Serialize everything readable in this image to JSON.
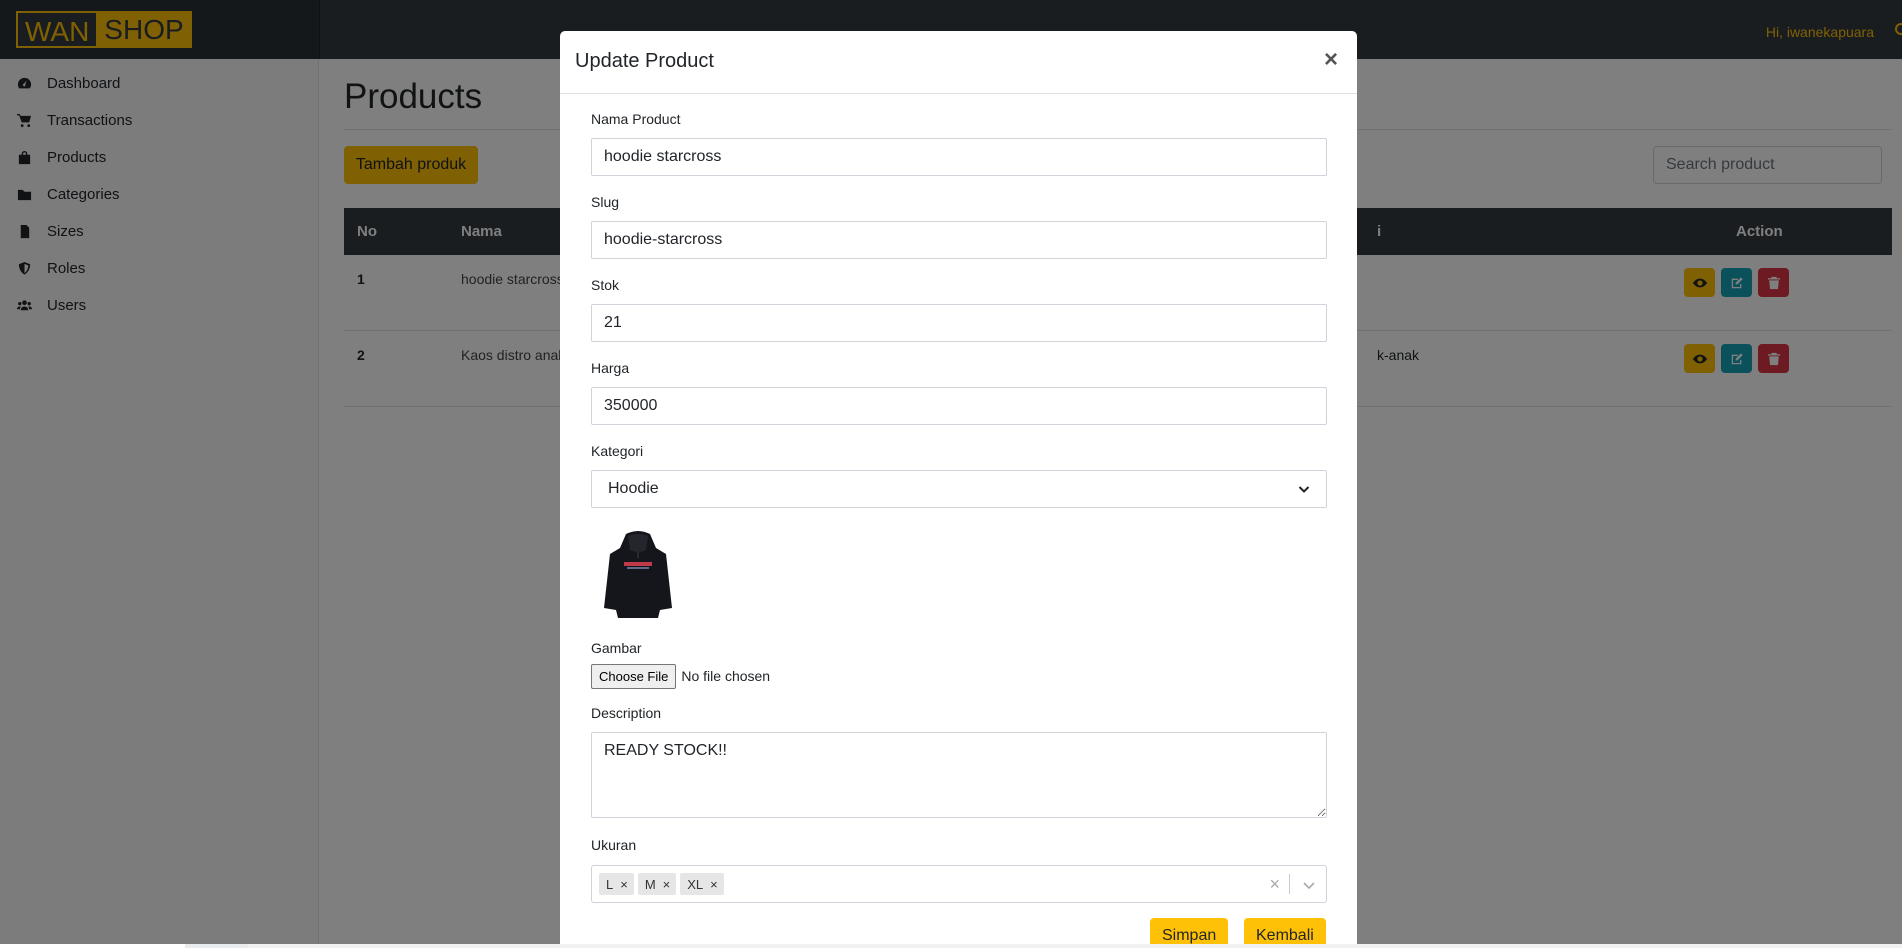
{
  "brand": {
    "part1": "WAN",
    "part2": "SHOP"
  },
  "navbar": {
    "greeting": "Hi, iwanekapuara",
    "signout_icon": "sign-out-icon"
  },
  "sidebar": {
    "items": [
      {
        "label": "Dashboard",
        "icon": "tachometer-icon"
      },
      {
        "label": "Transactions",
        "icon": "cart-icon"
      },
      {
        "label": "Products",
        "icon": "shopping-bag-icon"
      },
      {
        "label": "Categories",
        "icon": "folder-icon"
      },
      {
        "label": "Sizes",
        "icon": "sim-card-icon"
      },
      {
        "label": "Roles",
        "icon": "shield-icon"
      },
      {
        "label": "Users",
        "icon": "users-icon"
      }
    ]
  },
  "main": {
    "title": "Products",
    "add_button": "Tambah produk",
    "search_placeholder": "Search product",
    "table": {
      "headers": {
        "no": "No",
        "nama": "Nama",
        "kategori_partial": "i",
        "action": "Action"
      },
      "rows": [
        {
          "no": "1",
          "nama": "hoodie starcross",
          "kategori_partial": ""
        },
        {
          "no": "2",
          "nama": "Kaos distro anak",
          "kategori_partial": "k-anak"
        }
      ]
    }
  },
  "modal": {
    "title": "Update Product",
    "close": "×",
    "fields": {
      "nama_label": "Nama Product",
      "nama_value": "hoodie starcross",
      "slug_label": "Slug",
      "slug_value": "hoodie-starcross",
      "stok_label": "Stok",
      "stok_value": "21",
      "harga_label": "Harga",
      "harga_value": "350000",
      "kategori_label": "Kategori",
      "kategori_value": "Hoodie",
      "gambar_label": "Gambar",
      "file_button": "Choose File",
      "file_status": "No file chosen",
      "description_label": "Description",
      "description_value": "READY STOCK!!",
      "ukuran_label": "Ukuran",
      "ukuran_tags": [
        "L",
        "M",
        "XL"
      ]
    },
    "buttons": {
      "save": "Simpan",
      "back": "Kembali"
    }
  }
}
